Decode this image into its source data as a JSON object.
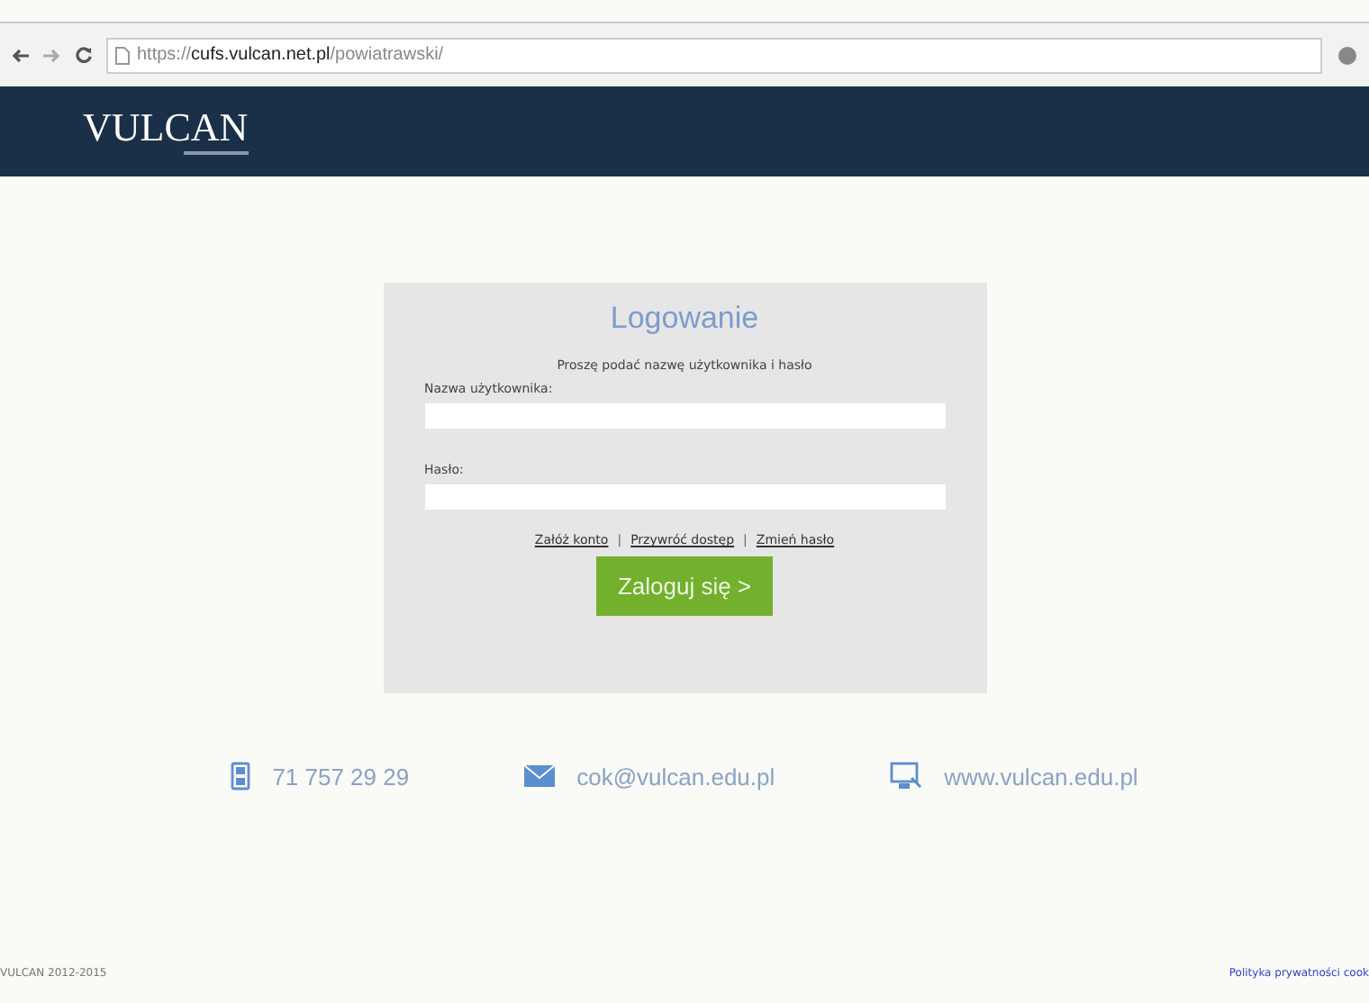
{
  "browser": {
    "url_scheme": "https://",
    "url_host": "cufs.vulcan.net.pl",
    "url_path": "/powiatrawski/"
  },
  "header": {
    "logo": "VULCAN"
  },
  "login": {
    "title": "Logowanie",
    "instruction": "Proszę podać nazwę użytkownika i hasło",
    "fields": [
      {
        "label": "Nazwa użytkownika:"
      },
      {
        "label": "Hasło:"
      }
    ],
    "links": [
      "Załóż konto",
      "Przywróć dostęp",
      "Zmień hasło"
    ],
    "separator": "|",
    "submit": "Zaloguj się >"
  },
  "contacts": [
    {
      "kind": "phone",
      "text": "71 757 29 29"
    },
    {
      "kind": "email",
      "text": "cok@vulcan.edu.pl"
    },
    {
      "kind": "web",
      "text": "www.vulcan.edu.pl"
    }
  ],
  "footer": {
    "copyright": "VULCAN 2012-2015",
    "privacy_link": "Polityka prywatności cook"
  }
}
